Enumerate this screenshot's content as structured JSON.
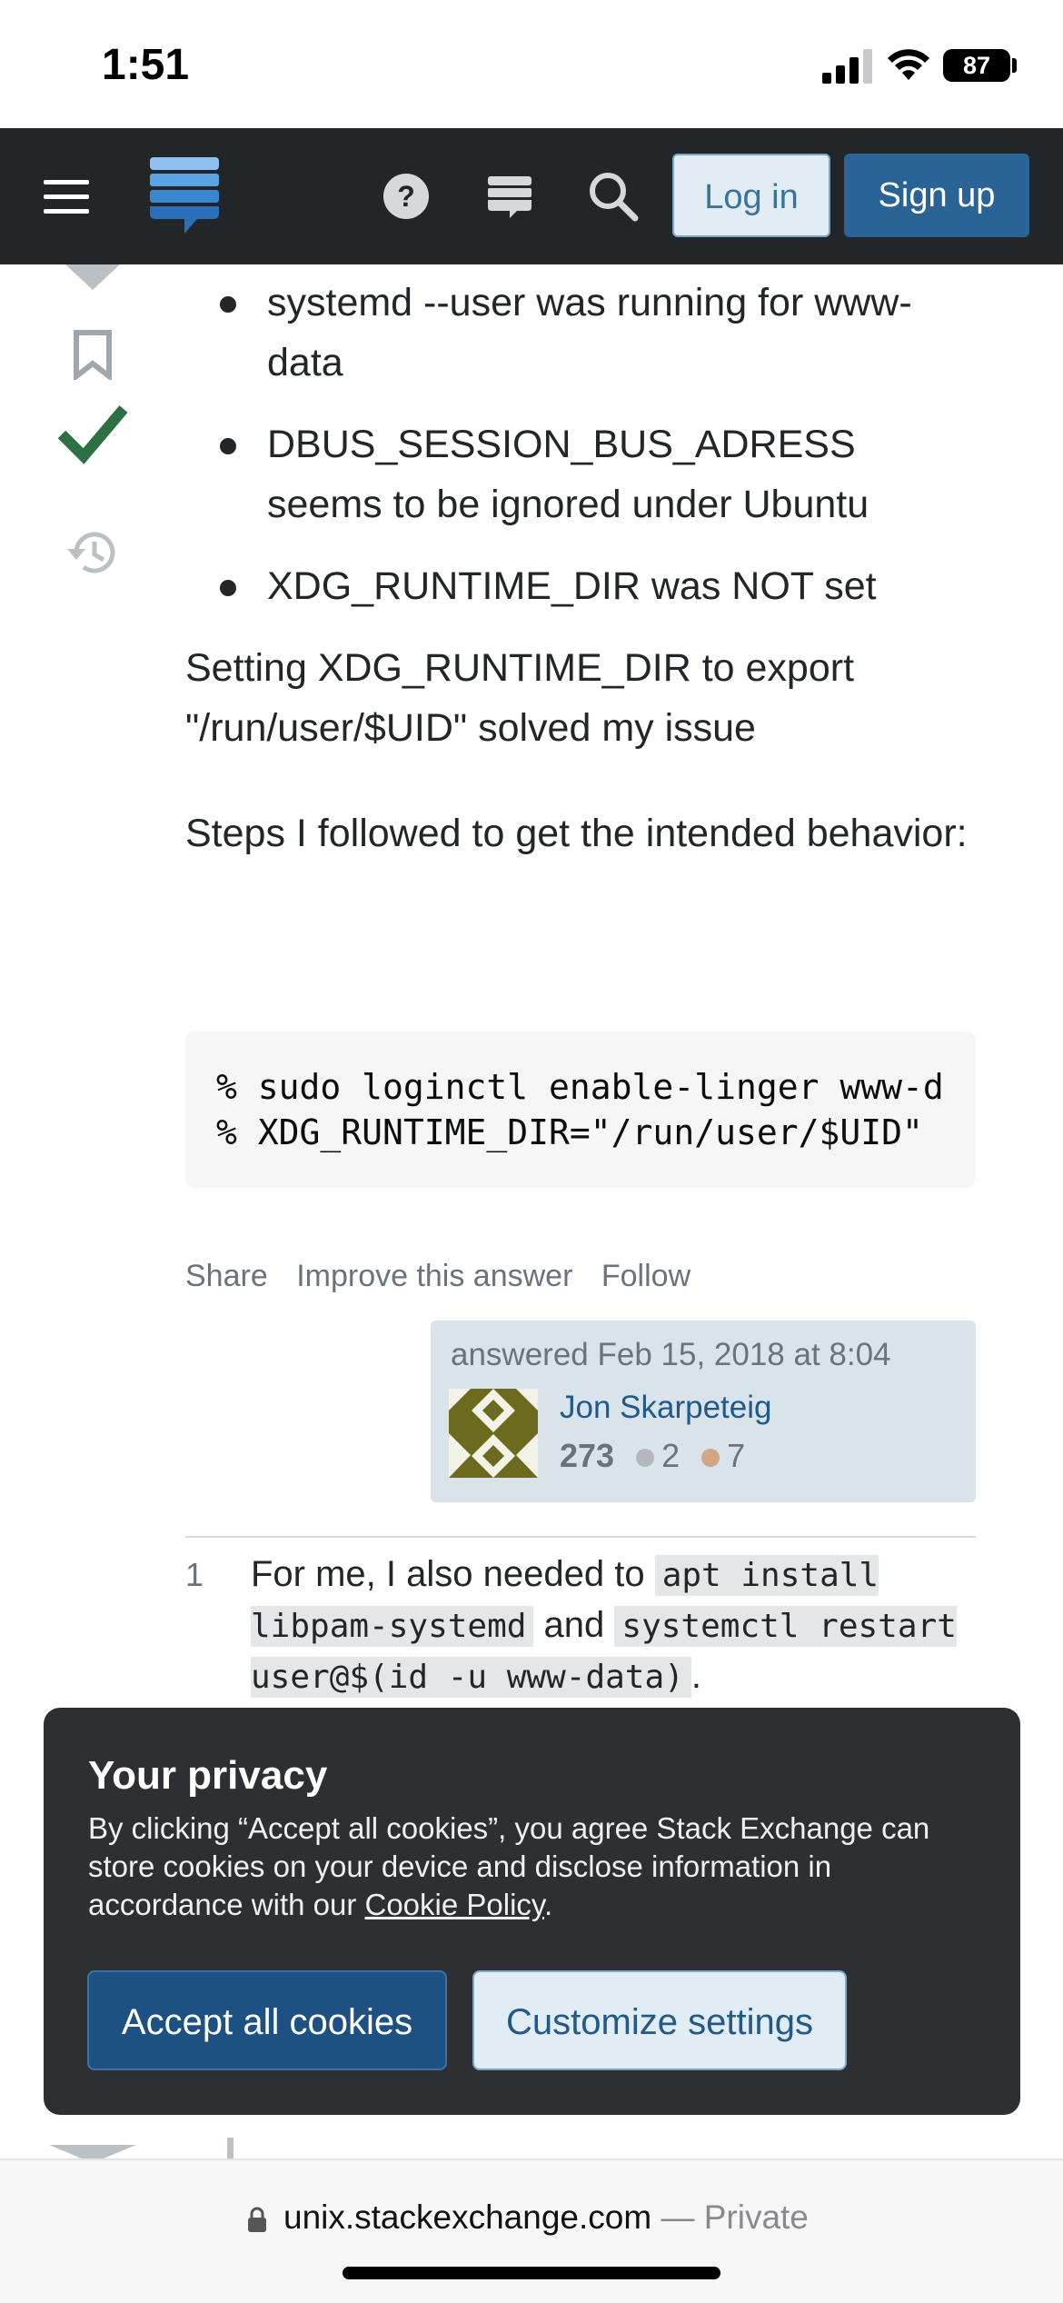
{
  "status_bar": {
    "time": "1:51",
    "battery": "87"
  },
  "nav": {
    "login_label": "Log in",
    "signup_label": "Sign up"
  },
  "answer": {
    "bullets": [
      "systemd --user was running for www-data",
      "DBUS_SESSION_BUS_ADRESS seems to be ignored under Ubuntu",
      "XDG_RUNTIME_DIR was NOT set"
    ],
    "paragraph_1": "Setting XDG_RUNTIME_DIR to export \"/run/user/$UID\" solved my issue",
    "paragraph_2": "Steps I followed to get the intended behavior:",
    "code_lines": [
      "% sudo loginctl enable-linger www-d",
      "% XDG_RUNTIME_DIR=\"/run/user/$UID\""
    ]
  },
  "post_menu": {
    "share": "Share",
    "improve": "Improve this answer",
    "follow": "Follow"
  },
  "user_card": {
    "answered": "answered Feb 15, 2018 at 8:04",
    "name": "Jon Skarpeteig",
    "reputation": "273",
    "silver_badges": "2",
    "bronze_badges": "7"
  },
  "comment": {
    "score": "1",
    "text_1": "For me, I also needed to ",
    "code_1": "apt install libpam-systemd",
    "text_2": " and ",
    "code_2": "systemctl restart user@$(id -u www-data)",
    "text_3": "."
  },
  "cookie_banner": {
    "title": "Your privacy",
    "body": "By clicking “Accept all cookies”, you agree Stack Exchange can store cookies on your device and disclose information in accordance with our ",
    "link": "Cookie Policy",
    "body_end": ".",
    "accept_label": "Accept all cookies",
    "customize_label": "Customize settings"
  },
  "url_bar": {
    "domain": "unix.stackexchange.com",
    "private": " — Private"
  },
  "colors": {
    "nav_bg": "#232629",
    "accent": "#2a6496",
    "accepted": "#2f6f44"
  }
}
